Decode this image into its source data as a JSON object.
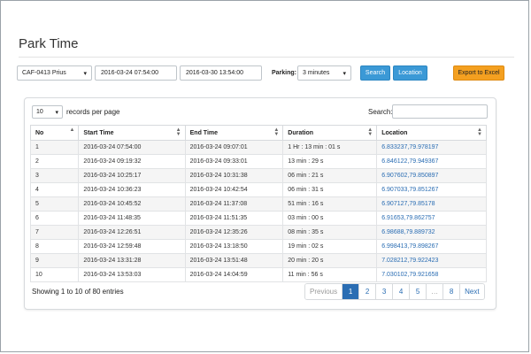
{
  "page": {
    "title": "Park Time"
  },
  "filters": {
    "vehicle": "CAF-0413 Prius",
    "from": "2016-03-24 07:54:00",
    "to": "2016-03-30 13:54:00",
    "parking_label": "Parking:",
    "parking_value": "3 minutes",
    "search_btn": "Search",
    "location_btn": "Location",
    "export_btn": "Export to Excel"
  },
  "table_controls": {
    "length_value": "10",
    "length_suffix": "records per page",
    "search_label": "Search:",
    "search_value": ""
  },
  "columns": [
    "No",
    "Start Time",
    "End Time",
    "Duration",
    "Location"
  ],
  "rows": [
    [
      "1",
      "2016-03-24 07:54:00",
      "2016-03-24 09:07:01",
      "1 Hr : 13 min : 01 s",
      "6.833237,79.978197"
    ],
    [
      "2",
      "2016-03-24 09:19:32",
      "2016-03-24 09:33:01",
      "13 min : 29 s",
      "6.846122,79.949367"
    ],
    [
      "3",
      "2016-03-24 10:25:17",
      "2016-03-24 10:31:38",
      "06 min : 21 s",
      "6.907602,79.850897"
    ],
    [
      "4",
      "2016-03-24 10:36:23",
      "2016-03-24 10:42:54",
      "06 min : 31 s",
      "6.907033,79.851267"
    ],
    [
      "5",
      "2016-03-24 10:45:52",
      "2016-03-24 11:37:08",
      "51 min : 16 s",
      "6.907127,79.85178"
    ],
    [
      "6",
      "2016-03-24 11:48:35",
      "2016-03-24 11:51:35",
      "03 min : 00 s",
      "6.91653,79.862757"
    ],
    [
      "7",
      "2016-03-24 12:26:51",
      "2016-03-24 12:35:26",
      "08 min : 35 s",
      "6.98688,79.889732"
    ],
    [
      "8",
      "2016-03-24 12:59:48",
      "2016-03-24 13:18:50",
      "19 min : 02 s",
      "6.998413,79.898267"
    ],
    [
      "9",
      "2016-03-24 13:31:28",
      "2016-03-24 13:51:48",
      "20 min : 20 s",
      "7.028212,79.922423"
    ],
    [
      "10",
      "2016-03-24 13:53:03",
      "2016-03-24 14:04:59",
      "11 min : 56 s",
      "7.030102,79.921658"
    ]
  ],
  "info": "Showing 1 to 10 of 80 entries",
  "pagination": [
    "Previous",
    "1",
    "2",
    "3",
    "4",
    "5",
    "…",
    "8",
    "Next"
  ],
  "pagination_active": "1",
  "colors": {
    "accent": "#3b99d6",
    "export": "#f4a020",
    "link": "#2a6db3"
  },
  "icons": {
    "dropdown": "chevron-down-icon",
    "sort": "sort-icon"
  }
}
